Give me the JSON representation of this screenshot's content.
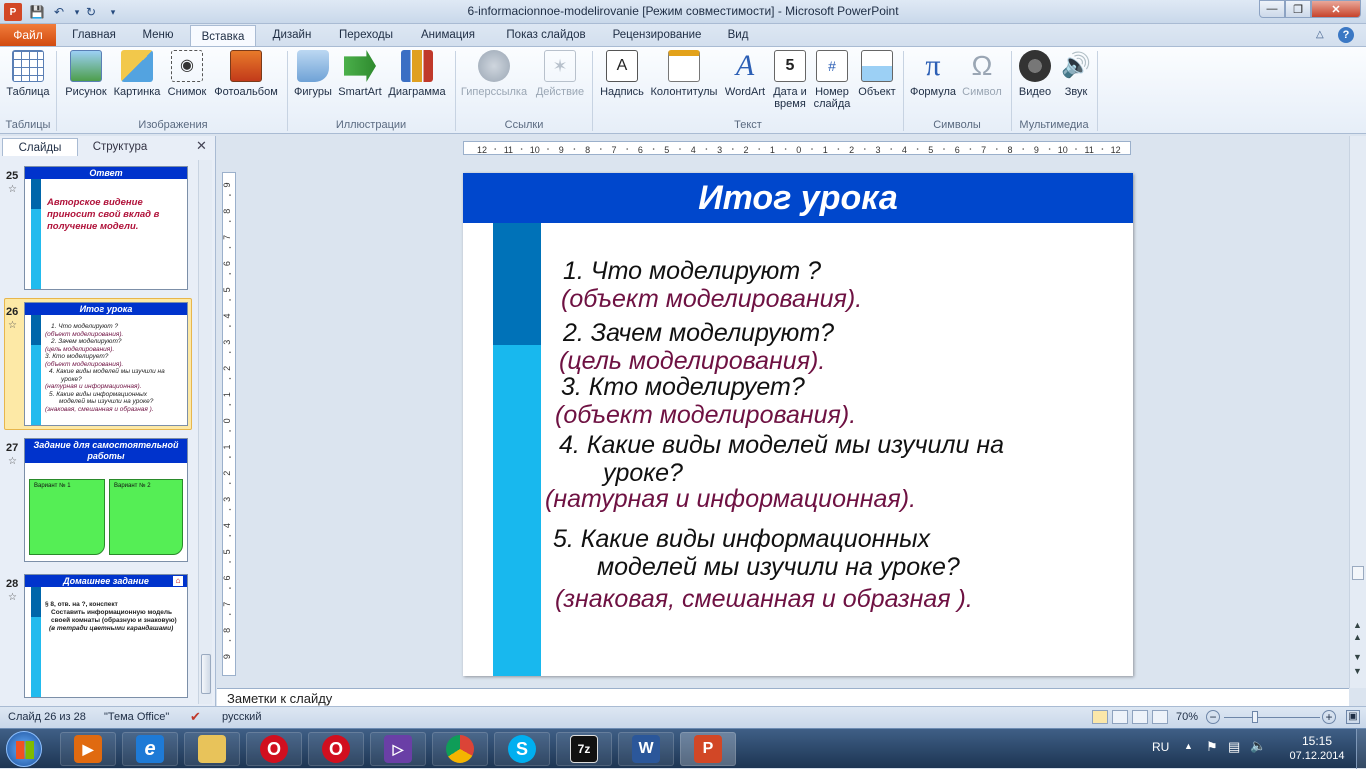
{
  "window": {
    "title": "6-informacionnoe-modelirovanie [Режим совместимости]  -  Microsoft PowerPoint"
  },
  "ribbon": {
    "file_tab": "Файл",
    "tabs": [
      "Главная",
      "Меню",
      "Вставка",
      "Дизайн",
      "Переходы",
      "Анимация",
      "Показ слайдов",
      "Рецензирование",
      "Вид"
    ],
    "active_tab": "Вставка",
    "buttons": {
      "table": "Таблица",
      "picture": "Рисунок",
      "clipart": "Картинка",
      "screenshot": "Снимок",
      "album": "Фотоальбом",
      "shapes": "Фигуры",
      "smartart": "SmartArt",
      "chart": "Диаграмма",
      "hyperlink": "Гиперссылка",
      "action": "Действие",
      "textbox": "Надпись",
      "headerfooter": "Колонтитулы",
      "wordart": "WordArt",
      "datetime1": "Дата и",
      "datetime2": "время",
      "slidenum1": "Номер",
      "slidenum2": "слайда",
      "object": "Объект",
      "formula": "Формула",
      "symbol": "Символ",
      "video": "Видео",
      "sound": "Звук"
    },
    "groups": {
      "tables": "Таблицы",
      "images": "Изображения",
      "illustrations": "Иллюстрации",
      "links": "Ссылки",
      "text": "Текст",
      "symbols": "Символы",
      "media": "Мультимедиа"
    }
  },
  "left_panel": {
    "tabs": [
      "Слайды",
      "Структура"
    ],
    "slides": [
      {
        "num": "25",
        "title": "Ответ",
        "text": "Авторское видение приносит свой вклад в получение модели."
      },
      {
        "num": "26",
        "title": "Итог урока",
        "lines": [
          "1.   Что моделируют ?",
          "(объект моделирования).",
          "2.   Зачем моделируют?",
          "(цель моделирования).",
          "3. Кто моделирует?",
          "(объект моделирования).",
          "4. Какие виды моделей мы изучили на",
          "уроке?",
          "(натурная и информационная).",
          "5. Какие виды информационных",
          "моделей мы изучили на уроке?",
          "(знаковая, смешанная и образная )."
        ]
      },
      {
        "num": "27",
        "title": "Задание для самостоятельной работы",
        "variant1": "Вариант № 1",
        "variant2": "Вариант № 2"
      },
      {
        "num": "28",
        "title": "Домашнее задание",
        "lines": [
          "§  8, отв. на ?, конспект",
          "Составить информационную модель своей комнаты (образную и знаковую)",
          "(в тетради цветными карандашами)"
        ]
      }
    ]
  },
  "slide": {
    "title": "Итог урока",
    "items": [
      {
        "q": "1.   Что моделируют ?",
        "a": "(объект моделирования)."
      },
      {
        "q": "2.   Зачем моделируют?",
        "a": "(цель моделирования)."
      },
      {
        "q": "3. Кто моделирует?",
        "a": "(объект моделирования)."
      },
      {
        "q": "4. Какие виды моделей мы изучили на",
        "q2": "уроке?",
        "a": "(натурная и информационная)."
      },
      {
        "q": "5. Какие виды информационных",
        "q2": "моделей мы изучили на уроке?",
        "a": "(знаковая, смешанная и образная )."
      }
    ]
  },
  "notes": {
    "placeholder": "Заметки к слайду"
  },
  "status": {
    "slide_info": "Слайд 26 из 28",
    "theme": "\"Тема Office\"",
    "language": "русский",
    "zoom": "70%"
  },
  "taskbar": {
    "lang": "RU",
    "time": "15:15",
    "date": "07.12.2014"
  },
  "ruler": {
    "h_labels": [
      "12",
      "11",
      "10",
      "9",
      "8",
      "7",
      "6",
      "5",
      "4",
      "3",
      "2",
      "1",
      "0",
      "1",
      "2",
      "3",
      "4",
      "5",
      "6",
      "7",
      "8",
      "9",
      "10",
      "11",
      "12"
    ],
    "v_labels": [
      "9",
      "8",
      "7",
      "6",
      "5",
      "4",
      "3",
      "2",
      "1",
      "0",
      "1",
      "2",
      "3",
      "4",
      "5",
      "6",
      "7",
      "8",
      "9"
    ]
  },
  "colors": {
    "slide_header": "#0047cc",
    "stripe_dark": "#0072b8",
    "stripe_light": "#18b8ee",
    "answer": "#6e1142"
  }
}
